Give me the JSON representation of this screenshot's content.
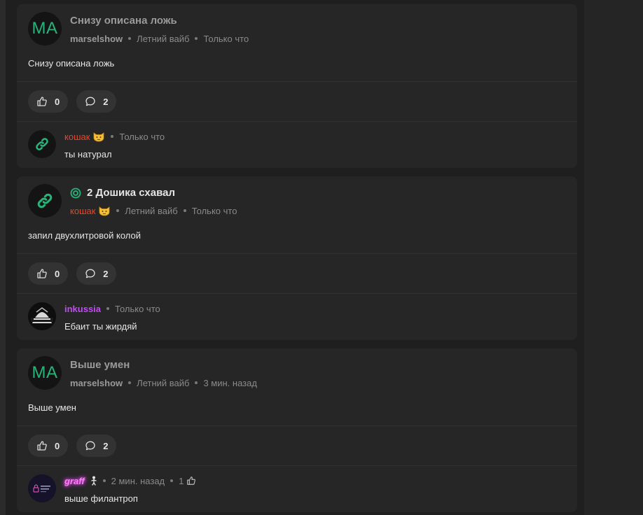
{
  "posts": [
    {
      "avatar_text": "MA",
      "title": "Снизу описана ложь",
      "author": "marselshow",
      "tag": "Летний вайб",
      "time": "Только что",
      "body": "Снизу описана ложь",
      "likes": "0",
      "comments": "2",
      "comment": {
        "author": "кошак",
        "time": "Только что",
        "text": "ты натурал"
      }
    },
    {
      "avatar_icon": "link-icon",
      "title": "2 Дошика схавал",
      "author": "кошак",
      "tag": "Летний вайб",
      "time": "Только что",
      "body": "запил двухлитровой колой",
      "likes": "0",
      "comments": "2",
      "comment": {
        "author": "inkussia",
        "time": "Только что",
        "text": "Ебаит ты жирдяй"
      }
    },
    {
      "avatar_text": "MA",
      "title": "Выше умен",
      "author": "marselshow",
      "tag": "Летний вайб",
      "time": "3 мин. назад",
      "body": "Выше умен",
      "likes": "0",
      "comments": "2",
      "comment": {
        "author": "graff",
        "time": "2 мин. назад",
        "likes": "1",
        "text": "выше филантроп"
      }
    }
  ],
  "colors": {
    "accent_green": "#27b47a",
    "author_red": "#e5462c",
    "author_purple": "#c04cf2",
    "author_pink": "#ff7bff"
  }
}
